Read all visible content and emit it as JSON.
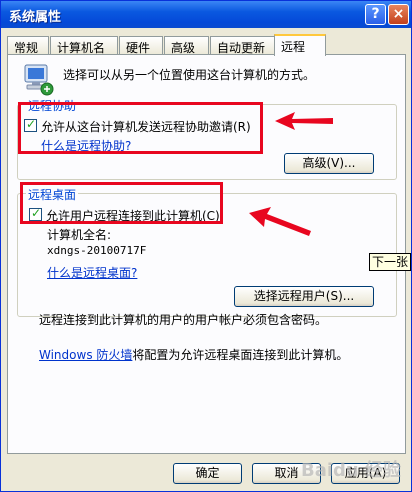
{
  "window": {
    "title": "系统属性",
    "help_icon": "?",
    "close_icon": "×"
  },
  "tabs": [
    {
      "label": "常规"
    },
    {
      "label": "计算机名"
    },
    {
      "label": "硬件"
    },
    {
      "label": "高级"
    },
    {
      "label": "自动更新"
    },
    {
      "label": "远程"
    }
  ],
  "intro": {
    "text": "选择可以从另一个位置使用这台计算机的方式。",
    "icon": "computer-network-icon"
  },
  "assistance": {
    "group_label": "远程协助",
    "checkbox_label": "允许从这台计算机发送远程协助邀请(R)",
    "checked": true,
    "help_link": "什么是远程协助?",
    "advanced_button": "高级(V)..."
  },
  "desktop": {
    "group_label": "远程桌面",
    "checkbox_label": "允许用户远程连接到此计算机(C)",
    "checked": true,
    "fullname_label": "计算机全名:",
    "fullname_value": "xdngs-20100717F",
    "help_link": "什么是远程桌面?",
    "select_users_button": "选择远程用户(S)..."
  },
  "password_note": "远程连接到此计算机的用户的用户帐户必须包含密码。",
  "firewall": {
    "link": "Windows 防火墙",
    "text": "将配置为允许远程桌面连接到此计算机。"
  },
  "tooltip": "下一张",
  "buttons": {
    "ok": "确定",
    "cancel": "取消",
    "apply": "应用(A)"
  },
  "watermark": "Baidu 经验",
  "colors": {
    "highlight_box": "#e8061f",
    "link": "#0033cc",
    "group_label": "#0046d5"
  }
}
